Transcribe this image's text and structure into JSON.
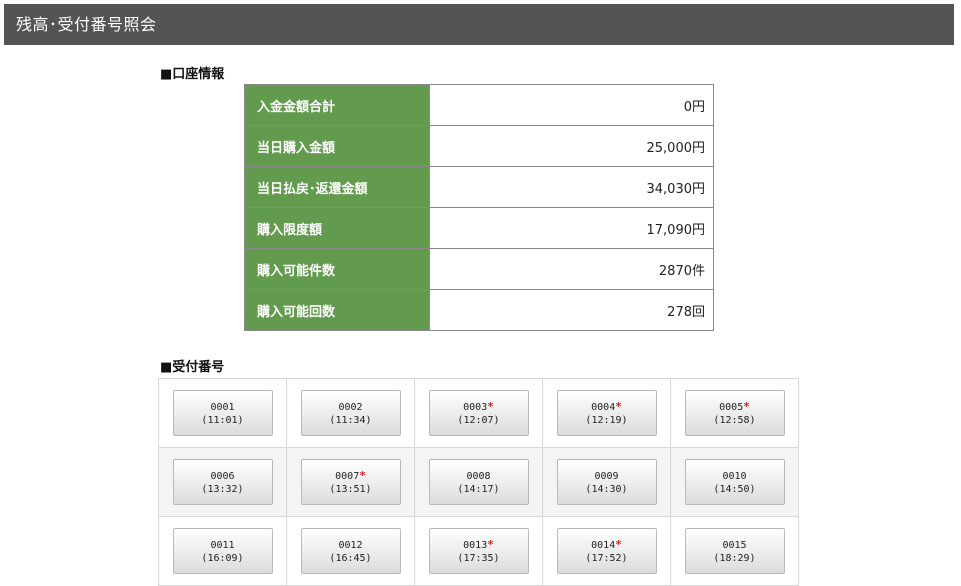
{
  "title": "残高･受付番号照会",
  "account_section": {
    "heading": "■口座情報",
    "rows": [
      {
        "label": "入金金額合計",
        "value": "0円"
      },
      {
        "label": "当日購入金額",
        "value": "25,000円"
      },
      {
        "label": "当日払戻･返還金額",
        "value": "34,030円"
      },
      {
        "label": "購入限度額",
        "value": "17,090円"
      },
      {
        "label": "購入可能件数",
        "value": "2870件"
      },
      {
        "label": "購入可能回数",
        "value": "278回"
      }
    ]
  },
  "receipt_section": {
    "heading": "■受付番号",
    "rows": [
      [
        {
          "number": "0001",
          "time": "(11:01)",
          "mark": ""
        },
        {
          "number": "0002",
          "time": "(11:34)",
          "mark": ""
        },
        {
          "number": "0003",
          "time": "(12:07)",
          "mark": "*"
        },
        {
          "number": "0004",
          "time": "(12:19)",
          "mark": "*"
        },
        {
          "number": "0005",
          "time": "(12:58)",
          "mark": "*"
        }
      ],
      [
        {
          "number": "0006",
          "time": "(13:32)",
          "mark": ""
        },
        {
          "number": "0007",
          "time": "(13:51)",
          "mark": "*"
        },
        {
          "number": "0008",
          "time": "(14:17)",
          "mark": ""
        },
        {
          "number": "0009",
          "time": "(14:30)",
          "mark": ""
        },
        {
          "number": "0010",
          "time": "(14:50)",
          "mark": ""
        }
      ],
      [
        {
          "number": "0011",
          "time": "(16:09)",
          "mark": ""
        },
        {
          "number": "0012",
          "time": "(16:45)",
          "mark": ""
        },
        {
          "number": "0013",
          "time": "(17:35)",
          "mark": "*"
        },
        {
          "number": "0014",
          "time": "(17:52)",
          "mark": "*"
        },
        {
          "number": "0015",
          "time": "(18:29)",
          "mark": ""
        }
      ]
    ]
  },
  "colors": {
    "titlebar": "#555353",
    "label_cell": "#629a4e",
    "mark": "#e02020"
  }
}
